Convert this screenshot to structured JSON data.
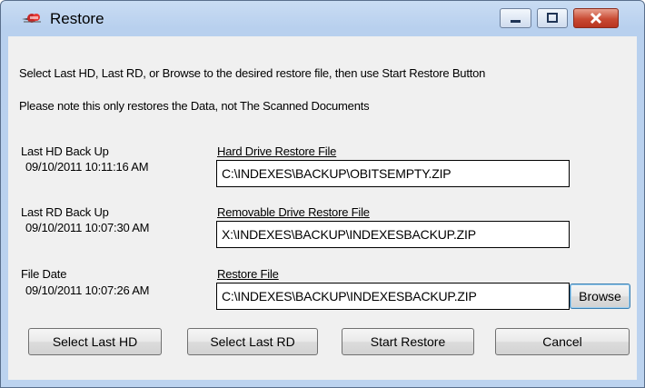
{
  "window": {
    "title": "Restore",
    "icon": "restore-app-icon"
  },
  "instructions": {
    "line1": "Select Last HD,  Last RD, or Browse to the desired restore  file, then use Start Restore Button",
    "line2": "Please note this only restores the Data, not The Scanned Documents"
  },
  "hd": {
    "label": "Last HD Back Up",
    "date": "09/10/2011 10:11:16 AM",
    "file_label": "Hard Drive Restore File",
    "file_value": "C:\\INDEXES\\BACKUP\\OBITSEMPTY.ZIP"
  },
  "rd": {
    "label": "Last RD Back Up",
    "date": "09/10/2011 10:07:30 AM",
    "file_label": "Removable Drive Restore File",
    "file_value": "X:\\INDEXES\\BACKUP\\INDEXESBACKUP.ZIP"
  },
  "file": {
    "label": "File Date",
    "date": "09/10/2011 10:07:26 AM",
    "file_label": "Restore File",
    "file_value": "C:\\INDEXES\\BACKUP\\INDEXESBACKUP.ZIP",
    "browse_label": "Browse"
  },
  "buttons": {
    "select_hd": "Select Last HD",
    "select_rd": "Select Last RD",
    "start_restore": "Start Restore",
    "cancel": "Cancel"
  },
  "colors": {
    "titlebar": "#c9dcf3",
    "client": "#f0f0f0",
    "close": "#c94a33"
  }
}
